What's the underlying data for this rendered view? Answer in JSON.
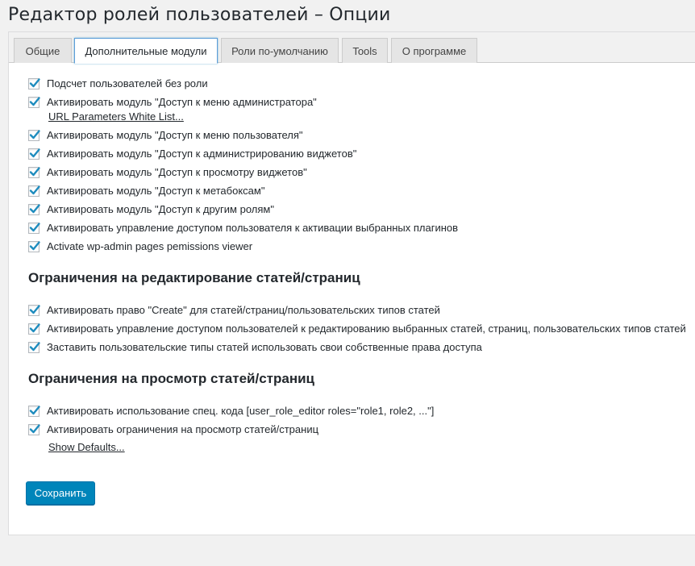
{
  "page": {
    "title": "Редактор ролей пользователей – Опции"
  },
  "tabs": [
    {
      "label": "Общие",
      "active": false
    },
    {
      "label": "Дополнительные модули",
      "active": true
    },
    {
      "label": "Роли по-умолчанию",
      "active": false
    },
    {
      "label": "Tools",
      "active": false
    },
    {
      "label": "О программе",
      "active": false
    }
  ],
  "modules": [
    {
      "label": "Подсчет пользователей без роли",
      "checked": true
    },
    {
      "label": "Активировать модуль \"Доступ к меню администратора\"",
      "checked": true,
      "link": "URL Parameters White List..."
    },
    {
      "label": "Активировать модуль \"Доступ к меню пользователя\"",
      "checked": true
    },
    {
      "label": "Активировать модуль \"Доступ к администрированию виджетов\"",
      "checked": true
    },
    {
      "label": "Активировать модуль \"Доступ к просмотру виджетов\"",
      "checked": true
    },
    {
      "label": "Активировать модуль \"Доступ к метабоксам\"",
      "checked": true
    },
    {
      "label": "Активировать модуль \"Доступ к другим ролям\"",
      "checked": true
    },
    {
      "label": "Активировать управление доступом пользователя к активации выбранных плагинов",
      "checked": true
    },
    {
      "label": "Activate wp-admin pages pemissions viewer",
      "checked": true
    }
  ],
  "edit_section": {
    "title": "Ограничения на редактирование статей/страниц",
    "options": [
      {
        "label": "Активировать право \"Create\" для статей/страниц/пользовательских типов статей",
        "checked": true
      },
      {
        "label": "Активировать управление доступом пользователей к редактированию выбранных статей, страниц, пользовательских типов статей",
        "checked": true
      },
      {
        "label": "Заставить пользовательские типы статей использовать свои собственные права доступа",
        "checked": true
      }
    ]
  },
  "view_section": {
    "title": "Ограничения на просмотр статей/страниц",
    "options": [
      {
        "label": "Активировать использование спец. кода [user_role_editor roles=\"role1, role2, ...\"]",
        "checked": true
      },
      {
        "label": "Активировать ограничения на просмотр статей/страниц",
        "checked": true
      }
    ],
    "link": "Show Defaults..."
  },
  "buttons": {
    "save": "Сохранить"
  },
  "colors": {
    "check": "#1e8cbe",
    "primary_button": "#0085ba",
    "active_tab_border": "#5b9dd9",
    "page_background": "#f1f1f1"
  }
}
